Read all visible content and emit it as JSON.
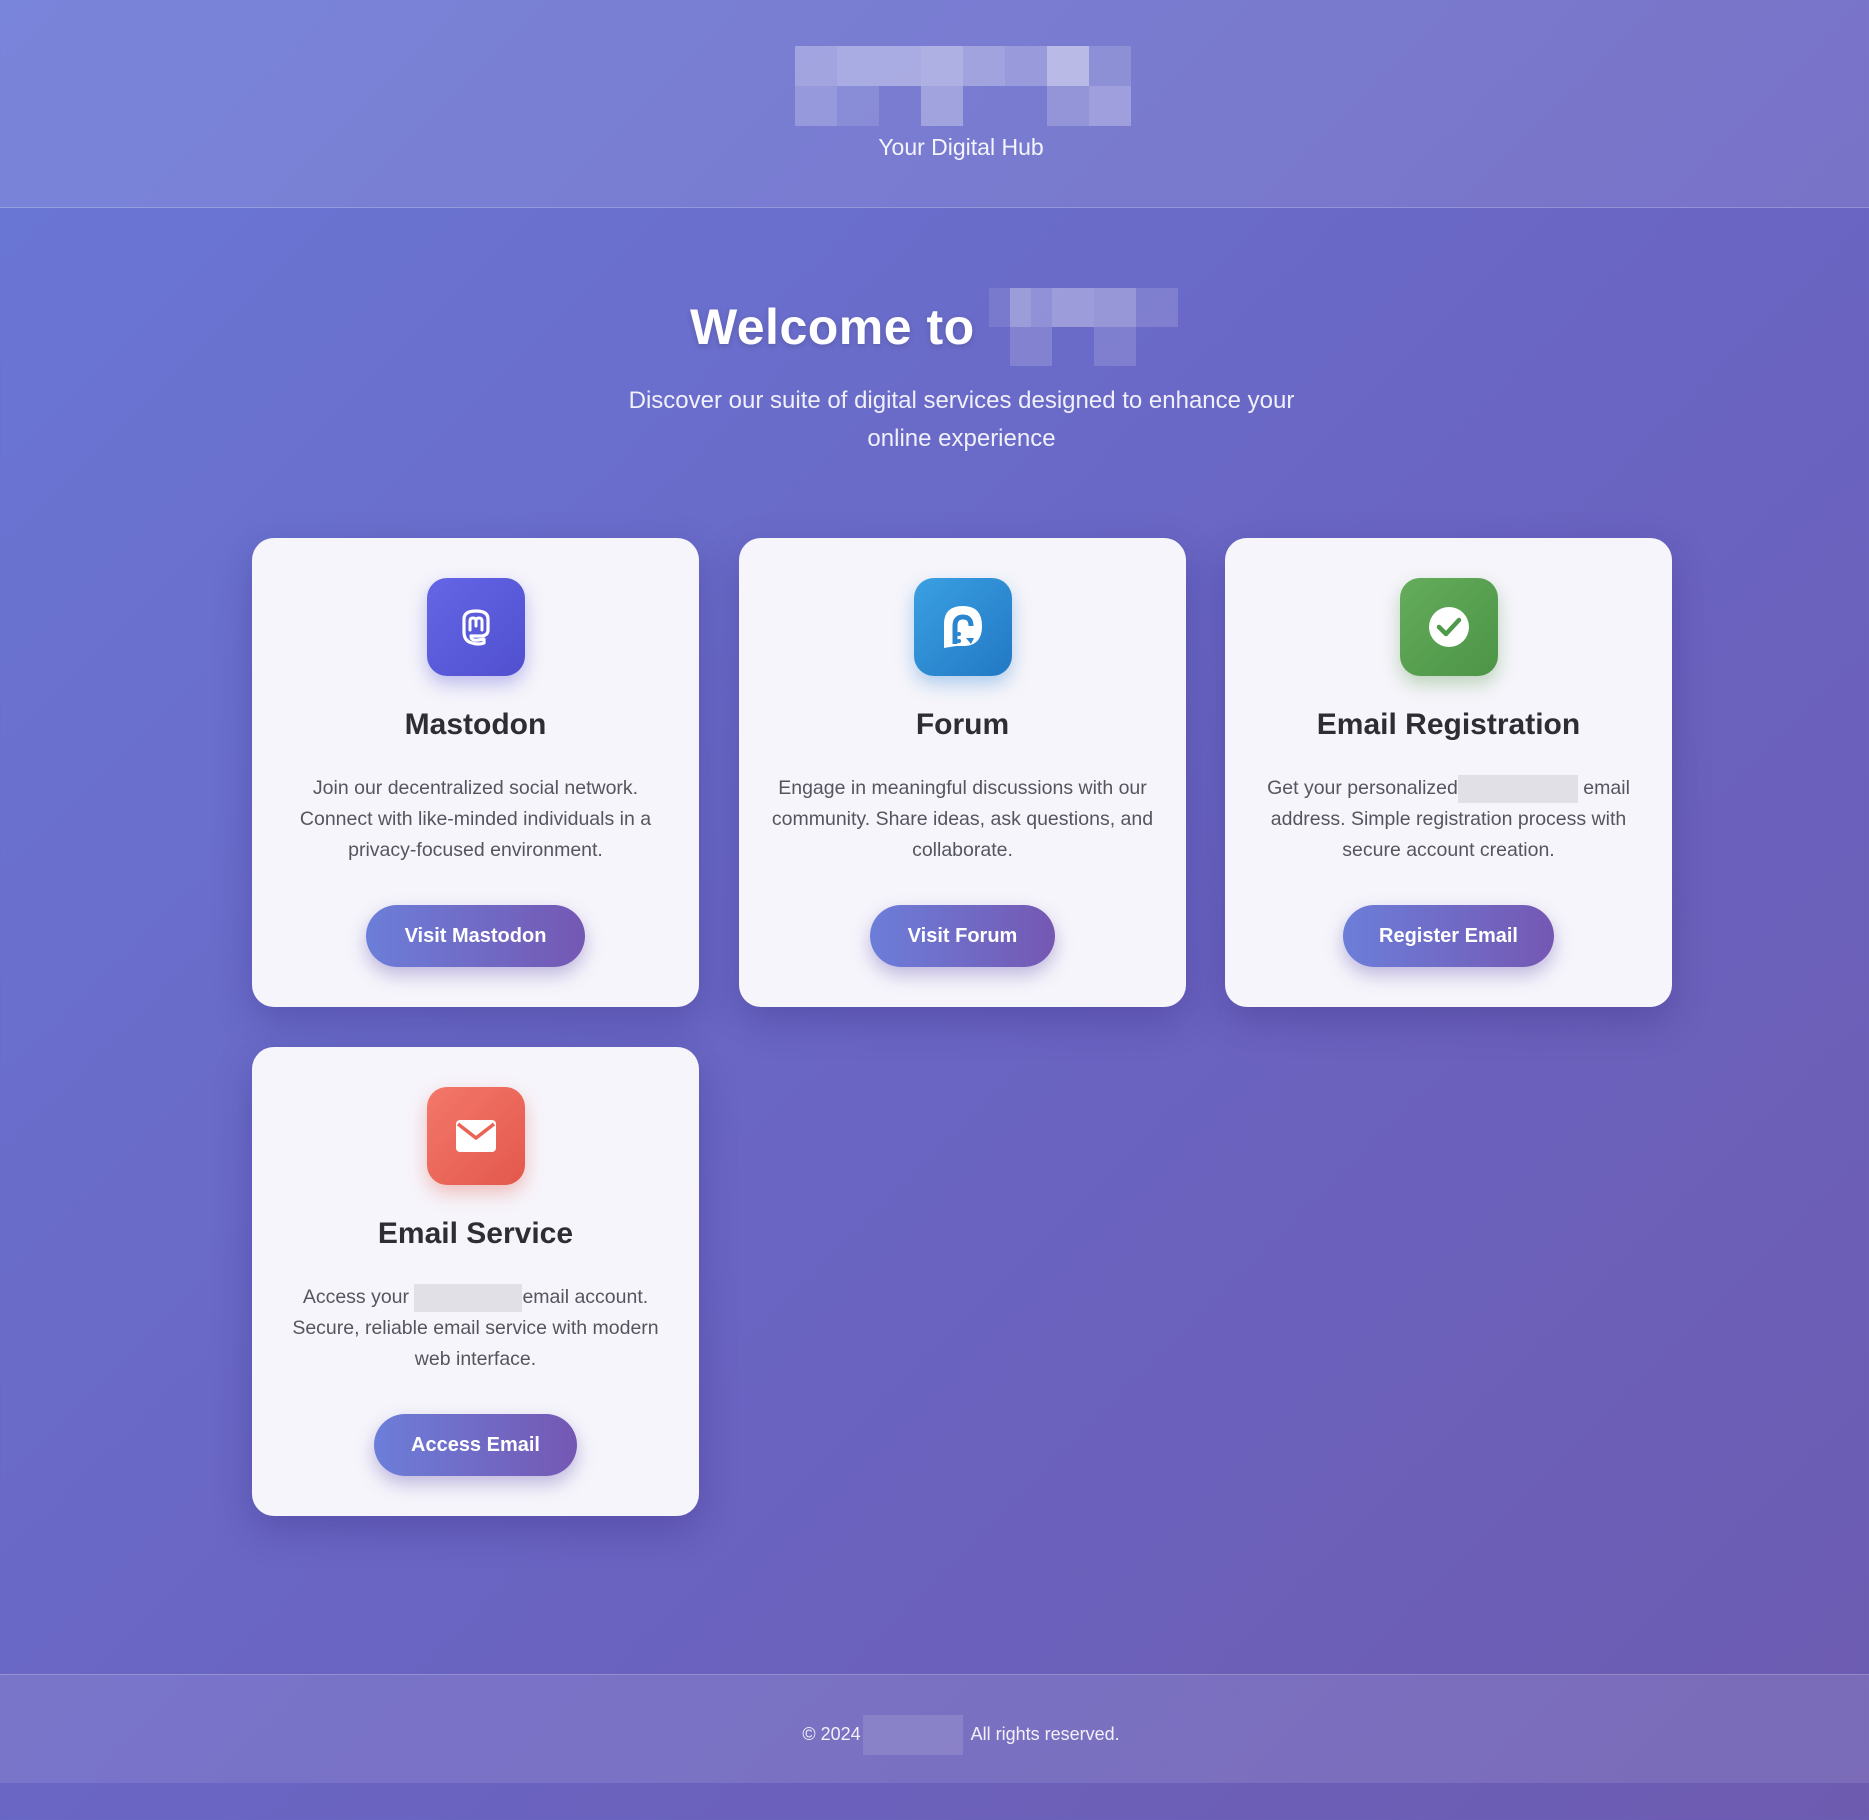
{
  "header": {
    "tagline": "Your Digital Hub"
  },
  "hero": {
    "title_prefix": "Welcome to",
    "subtitle": "Discover our suite of digital services designed to enhance your online experience"
  },
  "cards": [
    {
      "title": "Mastodon",
      "description": "Join our decentralized social network. Connect with like-minded individuals in a privacy-focused environment.",
      "button": "Visit Mastodon",
      "icon": "mastodon-icon",
      "color": "#5b5bdc"
    },
    {
      "title": "Forum",
      "description": "Engage in meaningful discussions with our community. Share ideas, ask questions, and collaborate.",
      "button": "Visit Forum",
      "icon": "forum-icon",
      "color": "#2f8fd8"
    },
    {
      "title": "Email Registration",
      "description_before": "Get your personalized",
      "description_after": "email address. Simple registration process with secure account creation.",
      "button": "Register Email",
      "icon": "check-circle-icon",
      "color": "#5aa552"
    },
    {
      "title": "Email Service",
      "description_before": "Access your",
      "description_after": "email account. Secure, reliable email service with modern web interface.",
      "button": "Access Email",
      "icon": "envelope-icon",
      "color": "#ef6a5a"
    }
  ],
  "footer": {
    "copyright_prefix": "© 2024",
    "rights": "All rights reserved."
  }
}
